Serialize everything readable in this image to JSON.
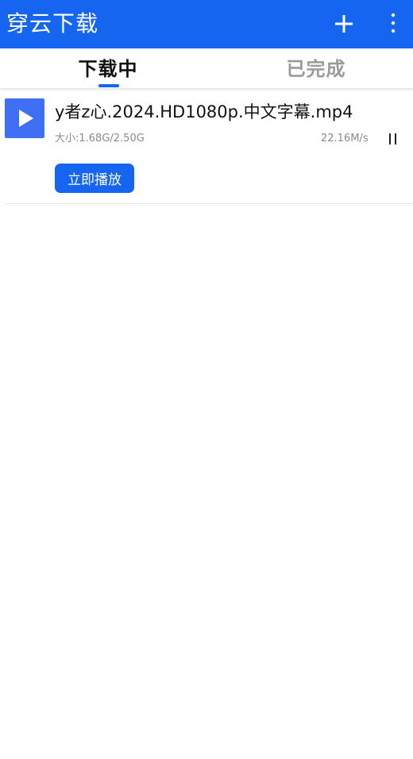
{
  "app_bar": {
    "title": "穿云下载",
    "add_icon": "plus-icon",
    "more_icon": "more-vertical-icon",
    "background_color": "#1565f0"
  },
  "tabs": [
    {
      "label": "下载中",
      "active": true
    },
    {
      "label": "已完成",
      "active": false
    }
  ],
  "downloads": [
    {
      "thumbnail_icon": "play-icon",
      "file_name": "y者z心.2024.HD1080p.中文字幕.mp4",
      "size_text": "大小:1.68G/2.50G",
      "speed": "22.16M/s",
      "pause_icon": "pause-icon",
      "play_now_label": "立即播放"
    }
  ],
  "colors": {
    "accent": "#1565f0",
    "thumbnail": "#3f6ff5",
    "inactive_tab": "#9a9a9a",
    "secondary_text": "#8a8a8a"
  }
}
